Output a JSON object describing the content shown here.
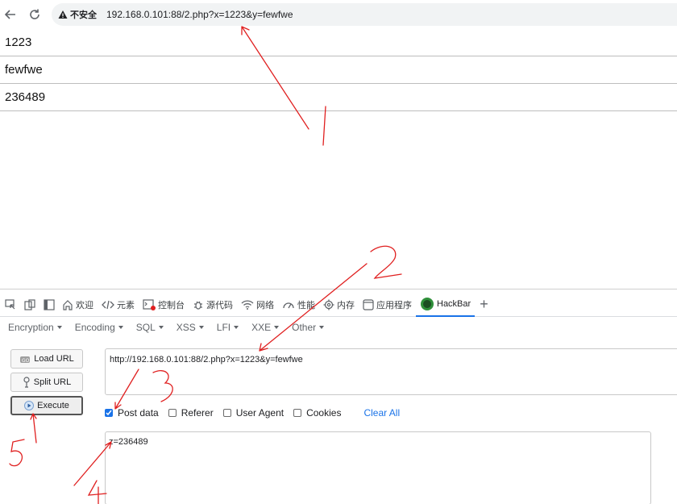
{
  "browser": {
    "security_label": "不安全",
    "url": "192.168.0.101:88/2.php?x=1223&y=fewfwe"
  },
  "page": {
    "lines": [
      "1223",
      "fewfwe",
      "236489"
    ]
  },
  "devtools": {
    "tabs": [
      {
        "label": "欢迎",
        "icon": "home-icon"
      },
      {
        "label": "元素",
        "icon": "code-icon"
      },
      {
        "label": "控制台",
        "icon": "console-icon"
      },
      {
        "label": "源代码",
        "icon": "bug-icon"
      },
      {
        "label": "网络",
        "icon": "wifi-icon"
      },
      {
        "label": "性能",
        "icon": "gauge-icon"
      },
      {
        "label": "内存",
        "icon": "gear-icon"
      },
      {
        "label": "应用程序",
        "icon": "window-icon"
      },
      {
        "label": "HackBar",
        "icon": "hackbar-logo-icon"
      }
    ],
    "active_tab": "HackBar"
  },
  "hackbar": {
    "menu": [
      "Encryption",
      "Encoding",
      "SQL",
      "XSS",
      "LFI",
      "XXE",
      "Other"
    ],
    "buttons": {
      "load": "Load URL",
      "split": "Split URL",
      "execute": "Execute"
    },
    "url_value": "http://192.168.0.101:88/2.php?x=1223&y=fewfwe",
    "options": {
      "post_data": {
        "label": "Post data",
        "checked": true
      },
      "referer": {
        "label": "Referer",
        "checked": false
      },
      "user_agent": {
        "label": "User Agent",
        "checked": false
      },
      "cookies": {
        "label": "Cookies",
        "checked": false
      }
    },
    "clear_all": "Clear All",
    "post_value": "z=236489"
  },
  "colors": {
    "accent": "#1a73e8",
    "annotation": "#e02020"
  }
}
